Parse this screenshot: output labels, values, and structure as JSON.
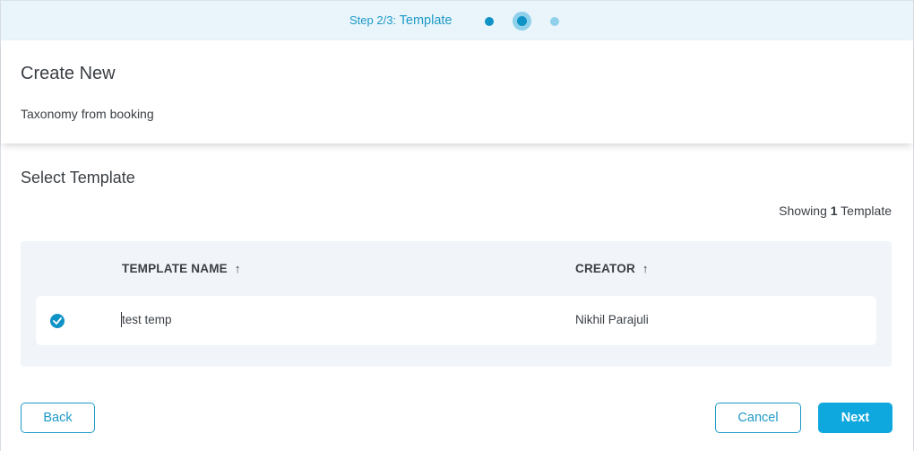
{
  "stepper": {
    "prefix": "Step 2/3: ",
    "step_name": "Template",
    "steps": [
      "done",
      "current",
      "pending"
    ]
  },
  "header": {
    "title": "Create New",
    "subtitle": "Taxonomy from booking"
  },
  "section": {
    "title": "Select Template",
    "showing_prefix": "Showing ",
    "showing_count": "1",
    "showing_suffix": " Template"
  },
  "table": {
    "columns": [
      {
        "label": "TEMPLATE NAME",
        "sort_icon": "arrow-up-icon"
      },
      {
        "label": "CREATOR",
        "sort_icon": "arrow-up-icon"
      }
    ],
    "rows": [
      {
        "selected": true,
        "name": "test temp",
        "creator": "Nikhil Parajuli"
      }
    ]
  },
  "actions": {
    "back_label": "Back",
    "cancel_label": "Cancel",
    "next_label": "Next"
  },
  "colors": {
    "accent": "#0f93c6",
    "primary_button": "#0fa8de",
    "step_bar_bg": "#e9f5fb",
    "table_bg": "#f1f4f8"
  }
}
